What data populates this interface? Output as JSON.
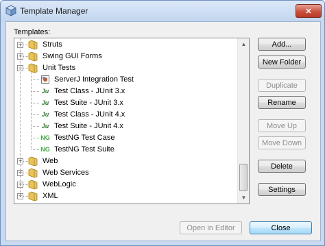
{
  "window": {
    "title": "Template Manager",
    "close_glyph": "✕"
  },
  "tree": {
    "label": "Templates:",
    "items": [
      {
        "label": "Struts",
        "kind": "folder",
        "expander": "+"
      },
      {
        "label": "Swing GUI Forms",
        "kind": "folder",
        "expander": "+"
      },
      {
        "label": "Unit Tests",
        "kind": "folder",
        "expander": "−"
      },
      {
        "label": "ServerJ Integration Test",
        "kind": "class",
        "icon_text": ""
      },
      {
        "label": "Test Class - JUnit 3.x",
        "kind": "junit",
        "icon_text": "Ju"
      },
      {
        "label": "Test Suite - JUnit 3.x",
        "kind": "junit",
        "icon_text": "Ju"
      },
      {
        "label": "Test Class - JUnit 4.x",
        "kind": "junit",
        "icon_text": "Ju"
      },
      {
        "label": "Test Suite - JUnit 4.x",
        "kind": "junit",
        "icon_text": "Ju"
      },
      {
        "label": "TestNG Test Case",
        "kind": "testng",
        "icon_text": "NG"
      },
      {
        "label": "TestNG Test Suite",
        "kind": "testng",
        "icon_text": "NG"
      },
      {
        "label": "Web",
        "kind": "folder",
        "expander": "+"
      },
      {
        "label": "Web Services",
        "kind": "folder",
        "expander": "+"
      },
      {
        "label": "WebLogic",
        "kind": "folder",
        "expander": "+"
      },
      {
        "label": "XML",
        "kind": "folder",
        "expander": "+"
      }
    ]
  },
  "buttons": {
    "add": "Add...",
    "new_folder": "New Folder",
    "duplicate": "Duplicate",
    "rename": "Rename",
    "move_up": "Move Up",
    "move_down": "Move Down",
    "delete": "Delete",
    "settings": "Settings",
    "open_in_editor": "Open in Editor",
    "close": "Close"
  },
  "colors": {
    "folder": "#e8c45a",
    "junit": "#2f7d2f",
    "testng": "#3fa83f",
    "accent": "#3c7fb1"
  }
}
